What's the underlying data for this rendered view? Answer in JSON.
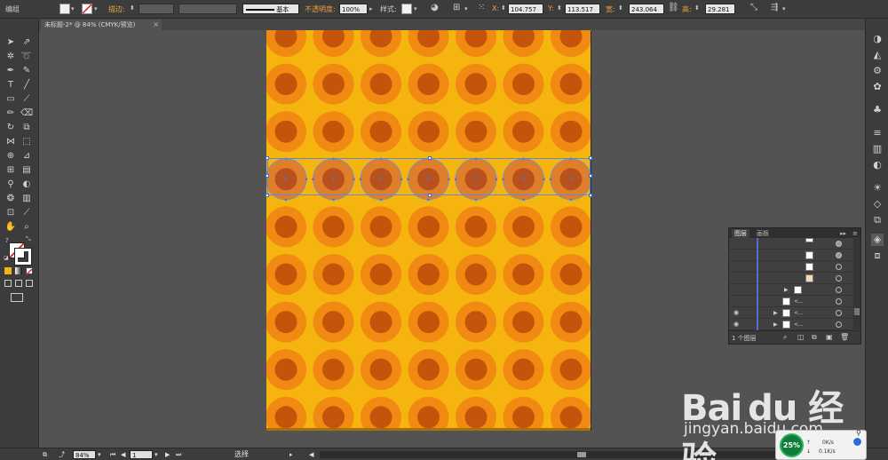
{
  "menu": {
    "mode_label": "编组"
  },
  "toolbar": {
    "stroke_label": "描边:",
    "stroke_style": "基本",
    "opacity_label": "不透明度:",
    "opacity_value": "100%",
    "style_label": "样式:",
    "x_label": "X:",
    "x_value": "104.757",
    "y_label": "Y:",
    "y_value": "113.517",
    "w_label": "宽:",
    "w_value": "243.064",
    "h_label": "高:",
    "h_value": "29.281"
  },
  "document": {
    "tab_title": "未标题-2* @ 84% (CMYK/预览)",
    "close_glyph": "×"
  },
  "tools": {
    "fill_stroke_hint": "?"
  },
  "artboard": {
    "bg_color": "#f6b40e",
    "outer_color": "#f08a12",
    "inner_color": "#c4540a",
    "columns": 7,
    "rows": 9,
    "selected_row": 3
  },
  "layers_panel": {
    "tab_layers": "图层",
    "tab_artboards": "画板",
    "collapse_glyph": "▸▸",
    "menu_glyph": "≡",
    "layer_count": "1 个图层",
    "row_label": "<..."
  },
  "status": {
    "zoom": "84%",
    "page": "1",
    "tool_status": "选择"
  },
  "watermark": {
    "logo_text": "Bai du 经验",
    "url": "jingyan.baidu.com"
  },
  "net_widget": {
    "percent": "25%",
    "up": "0K/s",
    "down": "0.1K/s"
  }
}
